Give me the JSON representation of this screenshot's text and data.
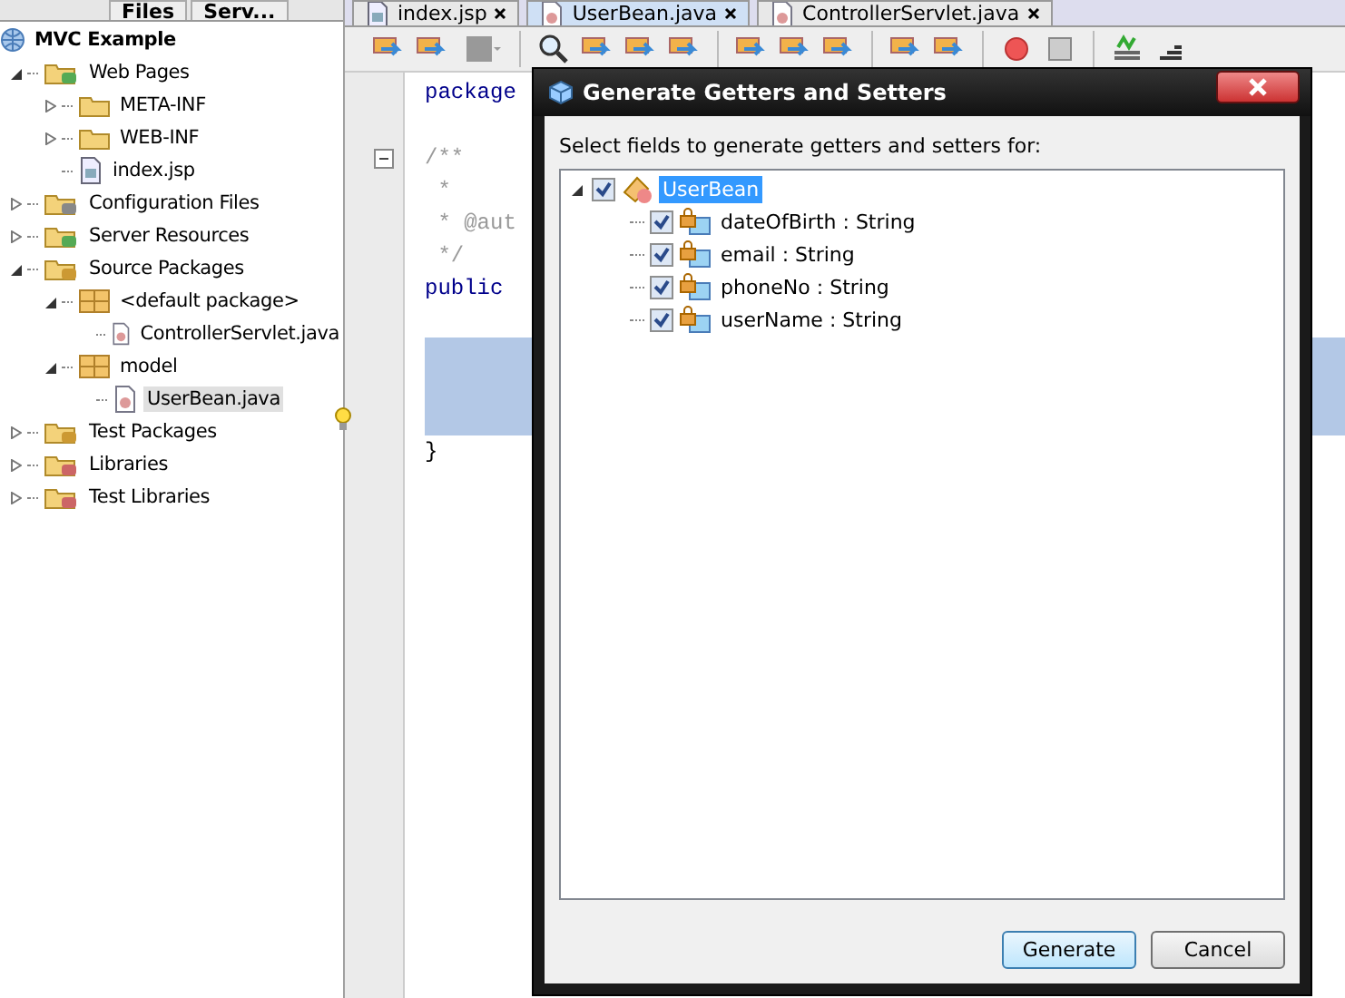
{
  "left_panel": {
    "tabs": [
      {
        "label": "Files",
        "selected": false
      },
      {
        "label": "Serv...",
        "selected": false
      }
    ],
    "tree": {
      "label": "MVC Example",
      "kind": "project",
      "children": [
        {
          "label": "Web Pages",
          "kind": "web",
          "expanded": true,
          "children": [
            {
              "label": "META-INF",
              "kind": "folder",
              "expanded": false
            },
            {
              "label": "WEB-INF",
              "kind": "folder",
              "expanded": false
            },
            {
              "label": "index.jsp",
              "kind": "jsp"
            }
          ]
        },
        {
          "label": "Configuration Files",
          "kind": "config",
          "expanded": false
        },
        {
          "label": "Server Resources",
          "kind": "server",
          "expanded": false
        },
        {
          "label": "Source Packages",
          "kind": "source",
          "expanded": true,
          "children": [
            {
              "label": "<default package>",
              "kind": "package",
              "expanded": true,
              "children": [
                {
                  "label": "ControllerServlet.java",
                  "kind": "java",
                  "selected": false
                }
              ]
            },
            {
              "label": "model",
              "kind": "package",
              "expanded": true,
              "children": [
                {
                  "label": "UserBean.java",
                  "kind": "java",
                  "selected": true
                }
              ]
            }
          ]
        },
        {
          "label": "Test Packages",
          "kind": "source",
          "expanded": false
        },
        {
          "label": "Libraries",
          "kind": "library",
          "expanded": false
        },
        {
          "label": "Test Libraries",
          "kind": "library",
          "expanded": false
        }
      ]
    }
  },
  "editor": {
    "tabs": [
      {
        "label": "index.jsp",
        "kind": "jsp",
        "selected": false
      },
      {
        "label": "UserBean.java",
        "kind": "java",
        "selected": true
      },
      {
        "label": "ControllerServlet.java",
        "kind": "java",
        "selected": false
      }
    ],
    "code_lines": [
      {
        "text": "package",
        "kind": "keyword"
      },
      {
        "kind": "blank"
      },
      {
        "text": "/**",
        "kind": "comment",
        "fold": true
      },
      {
        "text": " *",
        "kind": "comment"
      },
      {
        "text": " * @aut",
        "kind": "comment"
      },
      {
        "text": " */",
        "kind": "comment"
      },
      {
        "text": "public",
        "kind": "keyword"
      },
      {
        "kind": "blank"
      },
      {
        "kind": "highlight"
      },
      {
        "kind": "highlight"
      },
      {
        "kind": "highlight",
        "hint": true
      },
      {
        "text": "}",
        "kind": "plain"
      }
    ]
  },
  "dialog": {
    "title": "Generate Getters and Setters",
    "prompt": "Select fields to generate getters and setters for:",
    "root": {
      "label": "UserBean",
      "checked": true,
      "selected": true,
      "expanded": true,
      "children": [
        {
          "label": "dateOfBirth : String",
          "checked": true
        },
        {
          "label": "email : String",
          "checked": true
        },
        {
          "label": "phoneNo : String",
          "checked": true
        },
        {
          "label": "userName : String",
          "checked": true
        }
      ]
    },
    "buttons": [
      {
        "label": "Generate",
        "default": true
      },
      {
        "label": "Cancel",
        "default": false
      }
    ]
  }
}
